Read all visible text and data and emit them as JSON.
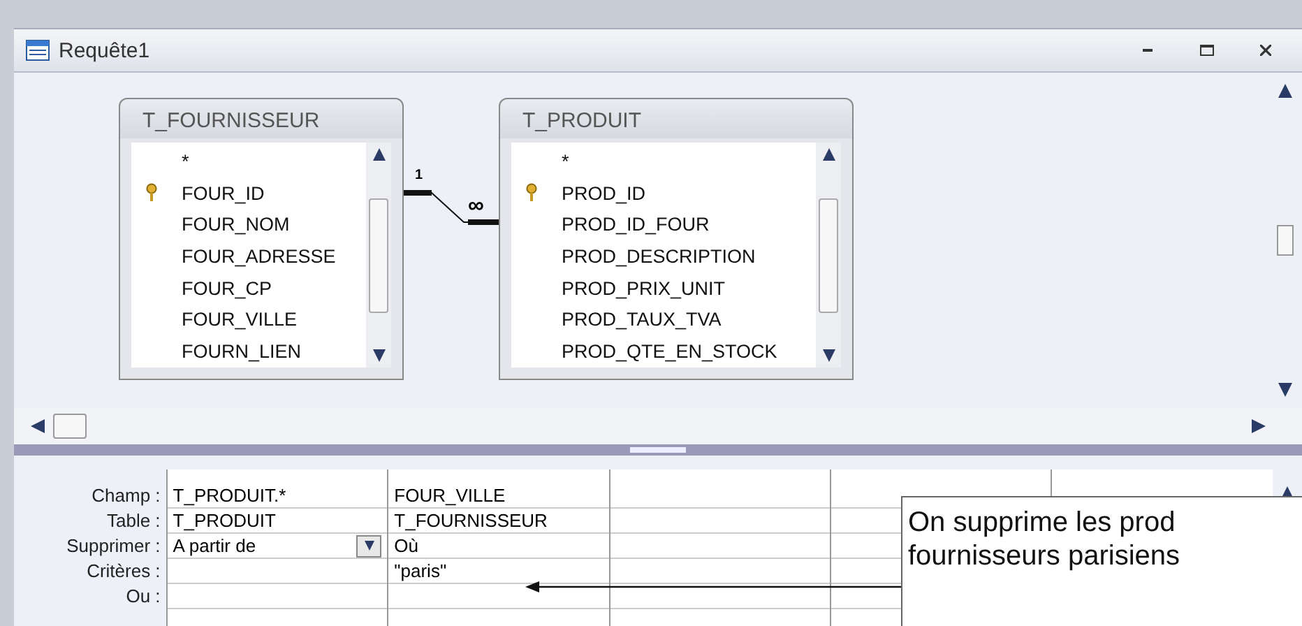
{
  "window": {
    "title": "Requête1"
  },
  "tables": [
    {
      "name": "T_FOURNISSEUR",
      "fields": [
        {
          "label": "*",
          "key": false
        },
        {
          "label": "FOUR_ID",
          "key": true
        },
        {
          "label": "FOUR_NOM",
          "key": false
        },
        {
          "label": "FOUR_ADRESSE",
          "key": false
        },
        {
          "label": "FOUR_CP",
          "key": false
        },
        {
          "label": "FOUR_VILLE",
          "key": false
        },
        {
          "label": "FOURN_LIEN",
          "key": false
        }
      ]
    },
    {
      "name": "T_PRODUIT",
      "fields": [
        {
          "label": "*",
          "key": false
        },
        {
          "label": "PROD_ID",
          "key": true
        },
        {
          "label": "PROD_ID_FOUR",
          "key": false
        },
        {
          "label": "PROD_DESCRIPTION",
          "key": false
        },
        {
          "label": "PROD_PRIX_UNIT",
          "key": false
        },
        {
          "label": "PROD_TAUX_TVA",
          "key": false
        },
        {
          "label": "PROD_QTE_EN_STOCK",
          "key": false
        }
      ]
    }
  ],
  "relation": {
    "one": "1",
    "many": "∞"
  },
  "grid": {
    "rows": [
      {
        "label": "Champ :",
        "cells": [
          {
            "kind": "text",
            "text": "T_PRODUIT.*"
          },
          {
            "kind": "text",
            "text": "FOUR_VILLE"
          }
        ]
      },
      {
        "label": "Table :",
        "cells": [
          {
            "kind": "text",
            "text": "T_PRODUIT"
          },
          {
            "kind": "text",
            "text": "T_FOURNISSEUR"
          }
        ]
      },
      {
        "label": "Supprimer :",
        "cells": [
          {
            "kind": "dropdown",
            "text": "A partir de"
          },
          {
            "kind": "text",
            "text": "Où"
          }
        ]
      },
      {
        "label": "Critères :",
        "cells": [
          {
            "kind": "empty"
          },
          {
            "kind": "text",
            "text": "\"paris\""
          }
        ]
      },
      {
        "label": "Ou :"
      }
    ]
  },
  "callout": {
    "lines": [
      "On supprime les prod",
      "fournisseurs parisiens"
    ]
  }
}
